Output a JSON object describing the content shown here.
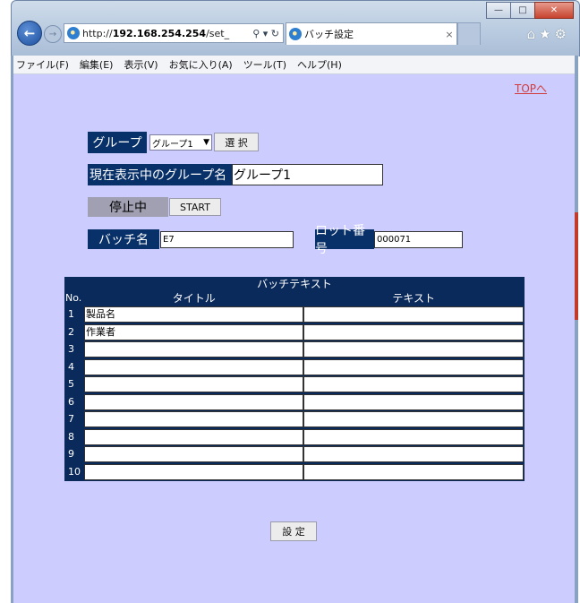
{
  "browser": {
    "url_prefix": "http://",
    "url_host": "192.168.254.254",
    "url_rest": "/set_",
    "address_tools": "⚲ ▾ ↻",
    "tab_title": "バッチ設定",
    "tab_close": "×",
    "window_buttons": [
      "—",
      "□",
      "✕"
    ],
    "back": "←",
    "forward": "→",
    "toolbar_icons": "⌂★⚙"
  },
  "menubar": [
    "ファイル(F)",
    "編集(E)",
    "表示(V)",
    "お気に入り(A)",
    "ツール(T)",
    "ヘルプ(H)"
  ],
  "page": {
    "top_link": "TOPへ",
    "group_label": "グループ",
    "group_selected": "グループ1",
    "select_button": "選 択",
    "current_group_label": "現在表示中のグループ名",
    "current_group_value": "グループ1",
    "status_text": "停止中",
    "start_button": "START",
    "batch_name_label": "バッチ名",
    "batch_name_value": "E7",
    "lot_label": "ロット番号",
    "lot_value": "000071",
    "set_button": "設 定"
  },
  "table": {
    "caption": "バッチテキスト",
    "headers": [
      "No.",
      "タイトル",
      "テキスト"
    ],
    "rows": [
      {
        "no": "1",
        "title": "製品名",
        "text": ""
      },
      {
        "no": "2",
        "title": "作業者",
        "text": ""
      },
      {
        "no": "3",
        "title": "",
        "text": ""
      },
      {
        "no": "4",
        "title": "",
        "text": ""
      },
      {
        "no": "5",
        "title": "",
        "text": ""
      },
      {
        "no": "6",
        "title": "",
        "text": ""
      },
      {
        "no": "7",
        "title": "",
        "text": ""
      },
      {
        "no": "8",
        "title": "",
        "text": ""
      },
      {
        "no": "9",
        "title": "",
        "text": ""
      },
      {
        "no": "10",
        "title": "",
        "text": ""
      }
    ]
  },
  "colors": {
    "page_bg": "#ccccff",
    "navy": "#083069",
    "link": "#d23b3b"
  }
}
